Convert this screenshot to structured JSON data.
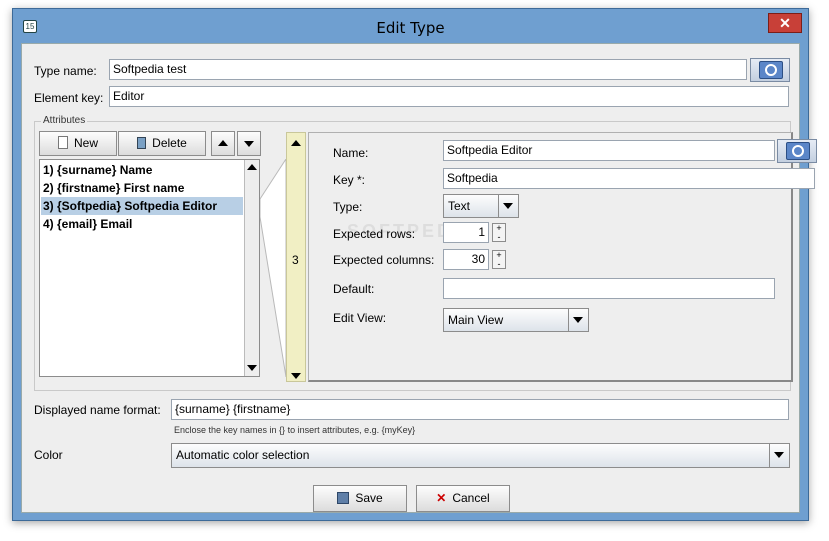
{
  "window": {
    "title": "Edit Type",
    "app_icon_text": "15"
  },
  "type_name": {
    "label": "Type name:",
    "value": "Softpedia test"
  },
  "element_key": {
    "label": "Element key:",
    "value": "Editor"
  },
  "attributes": {
    "group_title": "Attributes",
    "new_label": "New",
    "delete_label": "Delete",
    "items": [
      {
        "label": "1) {surname} Name",
        "selected": false
      },
      {
        "label": "2) {firstname} First name",
        "selected": false
      },
      {
        "label": "3) {Softpedia} Softpedia Editor",
        "selected": true
      },
      {
        "label": "4) {email} Email",
        "selected": false
      }
    ],
    "index_number": "3"
  },
  "detail": {
    "name_label": "Name:",
    "name_value": "Softpedia Editor",
    "key_label": "Key *:",
    "key_value": "Softpedia",
    "type_label": "Type:",
    "type_value": "Text",
    "rows_label": "Expected rows:",
    "rows_value": "1",
    "cols_label": "Expected columns:",
    "cols_value": "30",
    "default_label": "Default:",
    "default_value": "",
    "editview_label": "Edit View:",
    "editview_value": "Main View",
    "watermark": "SOFTPEDIA"
  },
  "display_format": {
    "label": "Displayed name format:",
    "value": "{surname} {firstname}",
    "hint": "Enclose the key names in {} to insert attributes, e.g. {myKey}"
  },
  "color": {
    "label": "Color",
    "value": "Automatic color selection"
  },
  "footer": {
    "save_label": "Save",
    "cancel_label": "Cancel"
  },
  "colors": {
    "accent_blue": "#6f9fd0",
    "selection": "#b8cfe5",
    "close_red": "#c84038",
    "index_bar": "#f1efc4"
  }
}
